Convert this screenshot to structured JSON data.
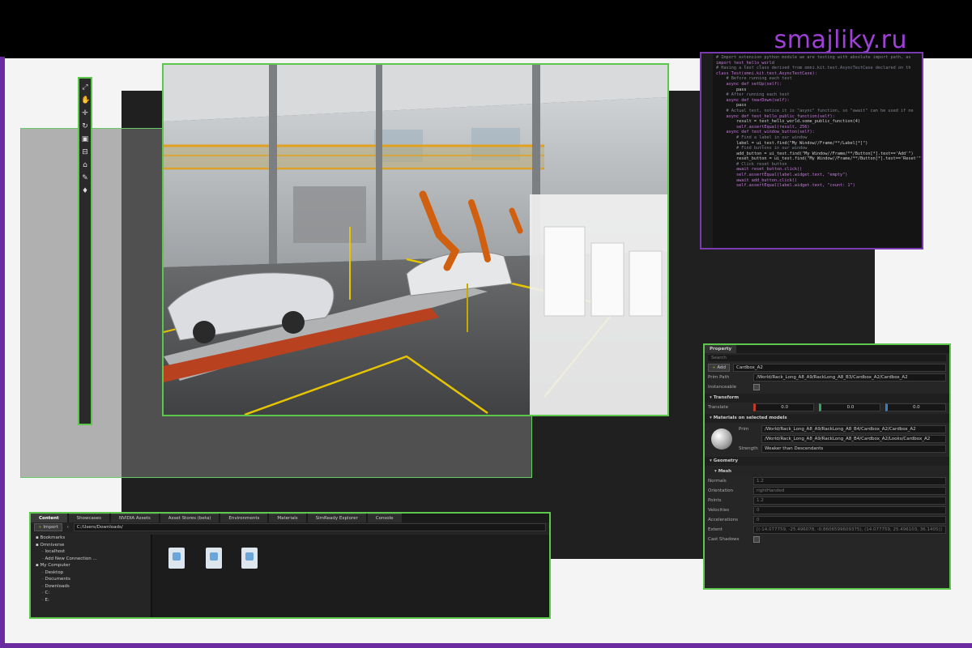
{
  "watermark": {
    "text": "smajliky.ru"
  },
  "colors": {
    "accent_green": "#5cc84a",
    "brand_purple": "#a040d8",
    "robot_orange": "#d06010",
    "floor_line_yellow": "#e6c400"
  },
  "toolbar": {
    "icons": [
      "select-icon",
      "hand-icon",
      "move-icon",
      "rotate-icon",
      "scale-icon",
      "snap-icon",
      "camera-icon",
      "paint-icon",
      "light-icon"
    ]
  },
  "code_editor": {
    "lines": [
      "# Import extension python module we are testing with absolute import path, as",
      "import test_hello_world",
      "",
      "# Having a test class derived from omni.kit.test.AsyncTestCase declared on th",
      "class Test(omni.kit.test.AsyncTestCase):",
      "    # Before running each test",
      "    async def setUp(self):",
      "        pass",
      "",
      "    # After running each test",
      "    async def tearDown(self):",
      "        pass",
      "",
      "    # Actual test, notice it is \"async\" function, so \"await\" can be used if ne",
      "    async def test_hello_public_function(self):",
      "        result = test_hello_world.some_public_function(4)",
      "        self.assertEqual(result, 256)",
      "",
      "",
      "    async def test_window_button(self):",
      "",
      "        # Find a label in our window",
      "        label = ui_test.find(\"My Window//Frame/**/Label[*]\")",
      "",
      "        # Find buttons in our window",
      "        add_button = ui_test.find(\"My Window//Frame/**/Button[*].text=='Add'\")",
      "        reset_button = ui_test.find(\"My Window//Frame/**/Button[*].text=='Reset'\")",
      "",
      "        # Click reset button",
      "        await reset_button.click()",
      "        self.assertEqual(label.widget.text, \"empty\")",
      "",
      "        await add_button.click()",
      "        self.assertEqual(label.widget.text, \"count: 1\")"
    ]
  },
  "property_panel": {
    "tab": "Property",
    "search_placeholder": "Search",
    "add_label": "Add",
    "name_value": "Cardbox_A2",
    "prim_path_label": "Prim Path",
    "prim_path_value": "/World/Rack_Long_A8_A9/RackLong_A8_B3/Cardbox_A2/Cardbox_A2",
    "instanceable_label": "Instanceable",
    "transform": {
      "section": "Transform",
      "translate_label": "Translate",
      "x": "0.0",
      "y": "0.0",
      "z": "0.0"
    },
    "materials": {
      "section": "Materials on selected models",
      "prim_label": "Prim",
      "prim_value": "/World/Rack_Long_A8_A9/RackLong_A8_B4/Cardbox_A2/Cardbox_A2",
      "material_value": "/World/Rack_Long_A8_A9/RackLong_A8_B4/Cardbox_A2/Looks/Cardbox_A2",
      "strength_label": "Strength",
      "strength_value": "Weaker than Descendants"
    },
    "geometry": {
      "section": "Geometry",
      "mesh_label": "Mesh",
      "rows": [
        {
          "label": "Normals",
          "value": "1.2"
        },
        {
          "label": "Orientation",
          "value": "rightHanded"
        },
        {
          "label": "Points",
          "value": "1.2"
        },
        {
          "label": "Velocities",
          "value": "0"
        },
        {
          "label": "Accelerations",
          "value": "0"
        },
        {
          "label": "Extent",
          "value": "[(-14.077759, -25.496078, -0.8606599609375), (14.077759, 25.496103, 36.1405)]"
        },
        {
          "label": "Cast Shadows",
          "value": ""
        }
      ]
    }
  },
  "content_browser": {
    "tabs": [
      "Content",
      "Showcases",
      "NVIDIA Assets",
      "Asset Stores (beta)",
      "Environments",
      "Materials",
      "SimReady Explorer",
      "Console"
    ],
    "import_label": "Import",
    "path": "C:/Users/Downloads/",
    "tree": [
      {
        "label": "Bookmarks",
        "indent": 0
      },
      {
        "label": "Omniverse",
        "indent": 0
      },
      {
        "label": "localhost",
        "indent": 1
      },
      {
        "label": "Add New Connection ...",
        "indent": 1
      },
      {
        "label": "My Computer",
        "indent": 0
      },
      {
        "label": "Desktop",
        "indent": 1
      },
      {
        "label": "Documents",
        "indent": 1
      },
      {
        "label": "Downloads",
        "indent": 1
      },
      {
        "label": "C:",
        "indent": 1
      },
      {
        "label": "E:",
        "indent": 1
      }
    ]
  }
}
